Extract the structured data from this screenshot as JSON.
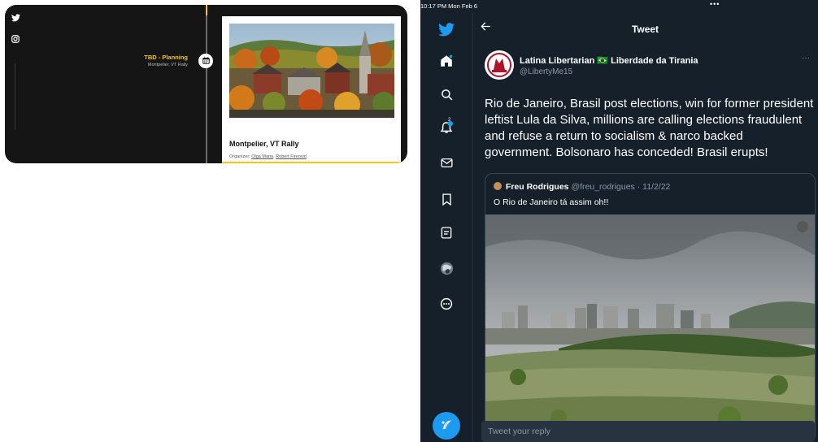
{
  "left": {
    "event": {
      "status": "TBD - Planning",
      "location": "Montpelier, VT Rally",
      "title": "Montpelier, VT Rally",
      "organizer_label": "Organizer:",
      "organizers": [
        "Olga Maria",
        "Robert Fireovid"
      ],
      "separator": ","
    },
    "icons": [
      "twitter-icon",
      "instagram-icon",
      "calendar-icon"
    ],
    "accent_color": "#f5c518"
  },
  "right": {
    "status_bar": {
      "time": "10:17 PM  Mon Feb 6",
      "dots": "•••"
    },
    "header": {
      "title": "Tweet"
    },
    "nav": [
      "twitter-logo-icon",
      "home-icon",
      "search-icon",
      "notifications-icon",
      "messages-icon",
      "bookmarks-icon",
      "lists-icon",
      "profile-icon",
      "more-icon"
    ],
    "notification_count": "2",
    "tweet": {
      "author_name": "Latina Libertarian 🇧🇷 Liberdade da Tirania",
      "handle": "@LibertyMe15",
      "more": "···",
      "text": "Rio de Janeiro, Brasil post elections, win for former president leftist Lula da Silva, millions are calling elections fraudulent and refuse a return to socialism & narco backed government. Bolsonaro has conceded! Brasil erupts!"
    },
    "quote": {
      "name": "Freu Rodrigues",
      "meta": "@freu_rodrigues · 11/2/22",
      "text": "O Rio de Janeiro tá assim oh!!"
    },
    "reply": {
      "placeholder": "Tweet your reply"
    },
    "accent_color": "#1d9bf0"
  }
}
